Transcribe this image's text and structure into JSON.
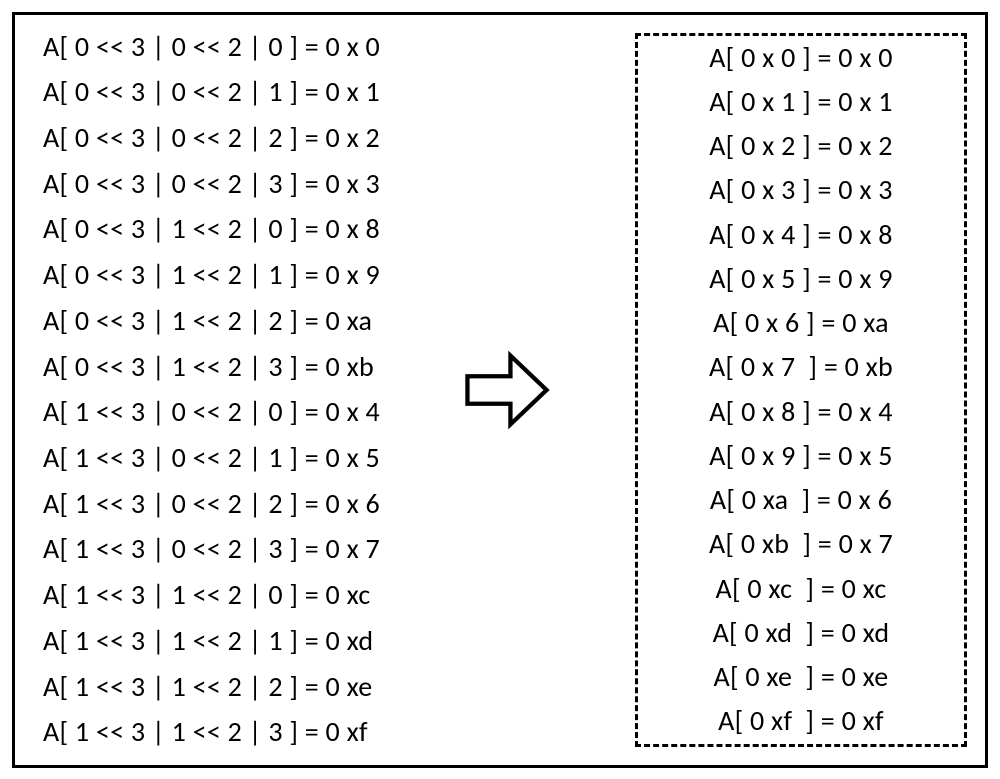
{
  "left": [
    "A[ 0 << 3 | 0 << 2 | 0 ] = 0 x 0",
    "A[ 0 << 3 | 0 << 2 | 1 ] = 0 x 1",
    "A[ 0 << 3 | 0 << 2 | 2 ] = 0 x 2",
    "A[ 0 << 3 | 0 << 2 | 3 ] = 0 x 3",
    "A[ 0 << 3 | 1 << 2 | 0 ] = 0 x 8",
    "A[ 0 << 3 | 1 << 2 | 1 ] = 0 x 9",
    "A[ 0 << 3 | 1 << 2 | 2 ] = 0 xa",
    "A[ 0 << 3 | 1 << 2 | 3 ] = 0 xb",
    "A[ 1 << 3 | 0 << 2 | 0 ] = 0 x 4",
    "A[ 1 << 3 | 0 << 2 | 1 ] = 0 x 5",
    "A[ 1 << 3 | 0 << 2 | 2 ] = 0 x 6",
    "A[ 1 << 3 | 0 << 2 | 3 ] = 0 x 7",
    "A[ 1 << 3 | 1 << 2 | 0 ] = 0 xc",
    "A[ 1 << 3 | 1 << 2 | 1 ] = 0 xd",
    "A[ 1 << 3 | 1 << 2 | 2 ] = 0 xe",
    "A[ 1 << 3 | 1 << 2 | 3 ] = 0 xf"
  ],
  "right": [
    "A[ 0 x 0 ] = 0 x 0",
    "A[ 0 x 1 ] = 0 x 1",
    "A[ 0 x 2 ] = 0 x 2",
    "A[ 0 x 3 ] = 0 x 3",
    "A[ 0 x 4 ] = 0 x 8",
    "A[ 0 x 5 ] = 0 x 9",
    "A[ 0 x 6 ] = 0 xa",
    "A[ 0 x 7  ] = 0 xb",
    "A[ 0 x 8 ] = 0 x 4",
    "A[ 0 x 9 ] = 0 x 5",
    "A[ 0 xa  ] = 0 x 6",
    "A[ 0 xb  ] = 0 x 7",
    "A[ 0 xc  ] = 0 xc",
    "A[ 0 xd  ] = 0 xd",
    "A[ 0 xe  ] = 0 xe",
    "A[ 0 xf  ] = 0 xf"
  ]
}
